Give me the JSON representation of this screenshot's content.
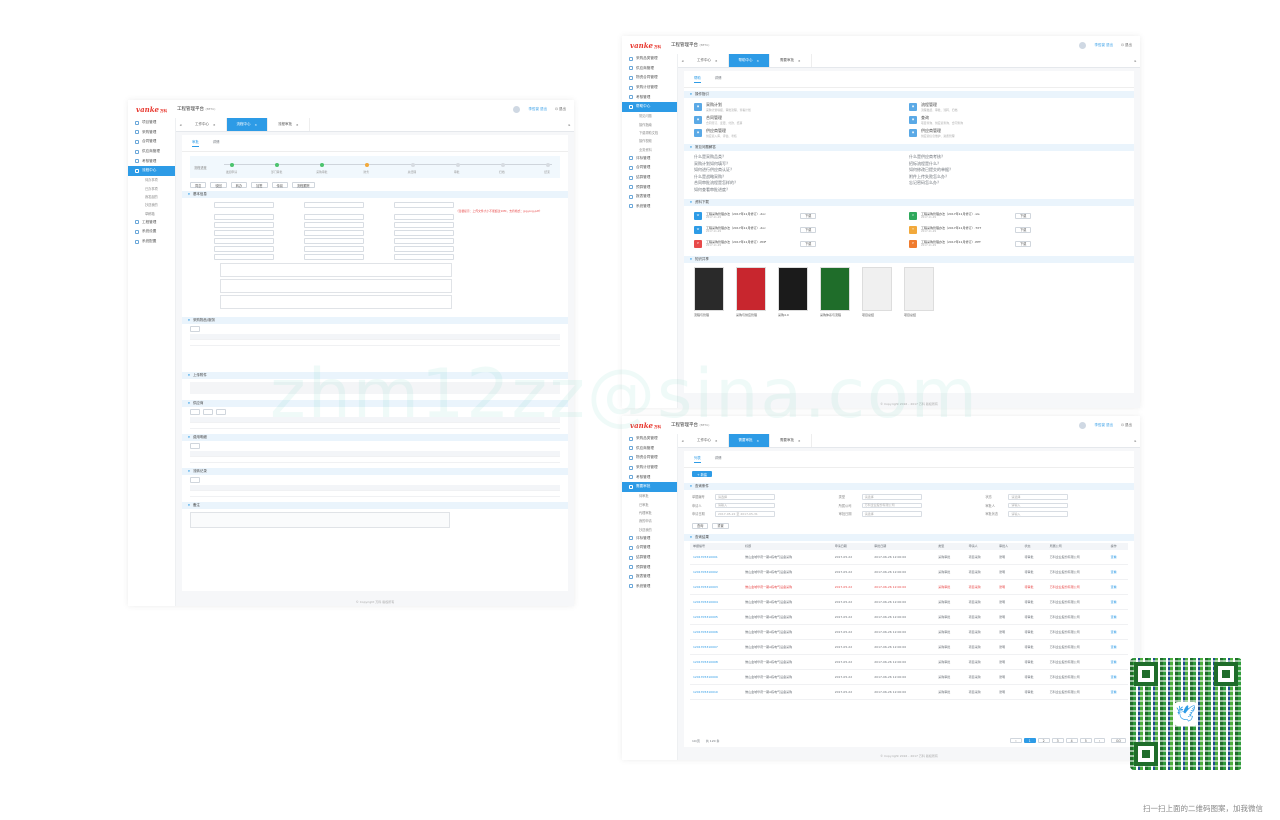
{
  "brand": {
    "logo": "vanke",
    "logo_cn": "万科",
    "app_title": "工程管理平台",
    "app_title_suffix": "(BETA)"
  },
  "colors": {
    "accent": "#2d9be6",
    "brand_red": "#e8382f",
    "done": "#4cc36e",
    "current": "#f2a93b"
  },
  "watermark": "zhm12zz@sina.com",
  "qr_caption": "扫一扫上面的二维码图案，加我微信",
  "left_screen": {
    "user": "李哲豪 退出",
    "logout": "退出",
    "nav": [
      {
        "label": "项目管理",
        "icon": "folder-icon"
      },
      {
        "label": "采购管理",
        "icon": "cart-icon"
      },
      {
        "label": "合同管理",
        "icon": "doc-icon"
      },
      {
        "label": "供应商管理",
        "icon": "users-icon"
      },
      {
        "label": "考核管理",
        "icon": "check-icon"
      },
      {
        "label": "流程中心",
        "icon": "flow-icon",
        "active": true
      },
      {
        "label": "待办事项",
        "sub": true
      },
      {
        "label": "已办事项",
        "sub": true
      },
      {
        "label": "我发起的",
        "sub": true
      },
      {
        "label": "抄送我的",
        "sub": true
      },
      {
        "label": "草稿箱",
        "sub": true
      },
      {
        "label": "工程管理",
        "icon": "build-icon"
      },
      {
        "label": "系统设置",
        "icon": "gear-icon"
      },
      {
        "label": "系统配置",
        "icon": "cog-icon"
      }
    ],
    "tabs": [
      "工作中心",
      "流程中心",
      "流程审批"
    ],
    "subtabs": [
      "审批",
      "详情"
    ],
    "flow_label": "流程进度",
    "steps": [
      "发起申请",
      "部门审批",
      "采购审批",
      "财务",
      "总经理",
      "审批",
      "归档",
      "结束"
    ],
    "actions": [
      "同意",
      "驳回",
      "转办",
      "加签",
      "传阅",
      "流程跟踪"
    ],
    "sections": [
      "基本信息",
      "采购物品/服务",
      "上传附件",
      "供应商",
      "费用明细",
      "流转记录",
      "备注"
    ],
    "warning": "（温馨提示：上传文件大小不能超过10M，支持格式：jpg,png,pdf）",
    "footer": "© Copyright 万科 版权所有"
  },
  "right_top": {
    "user": "李哲豪 退出",
    "logout": "退出",
    "nav": [
      {
        "label": "采购品类管理"
      },
      {
        "label": "供应商管理"
      },
      {
        "label": "物资合同管理"
      },
      {
        "label": "采购计划管理"
      },
      {
        "label": "考核管理"
      },
      {
        "label": "帮助中心",
        "active": true
      },
      {
        "label": "常见问题",
        "sub": true
      },
      {
        "label": "操作指南",
        "sub": true
      },
      {
        "label": "下载帮助文档",
        "sub": true
      },
      {
        "label": "操作视频",
        "sub": true
      },
      {
        "label": "业务资料",
        "sub": true
      },
      {
        "label": "评标管理"
      },
      {
        "label": "合同管理"
      },
      {
        "label": "结算管理"
      },
      {
        "label": "预算管理"
      },
      {
        "label": "报表管理"
      },
      {
        "label": "系统管理"
      }
    ],
    "tabs": [
      "工作中心",
      "帮助中心",
      "需要审批"
    ],
    "subtabs": [
      "帮助",
      "详情"
    ],
    "guide_section": "操作指引",
    "guides": [
      {
        "title": "采购计划",
        "desc": "采购计划填报、审批流程、查看计划"
      },
      {
        "title": "流程管理",
        "desc": "流程发起、审批、流转、归档"
      },
      {
        "title": "合同管理",
        "desc": "合同签订、变更、付款、结算"
      },
      {
        "title": "查询",
        "desc": "项目查询、供应商查询、合同查询"
      },
      {
        "title": "供应商管理",
        "desc": "供应商入库、评估、考核"
      },
      {
        "title": "供应商管理",
        "desc": "供应商信息维护、资质管理"
      }
    ],
    "faq_section": "常见问题解答",
    "faqs_left": [
      "什么是采购品类？",
      "采购计划如何填写？",
      "如何进行供应商认证？",
      "什么是战略采购？",
      "合同审批流程是怎样的？",
      "如何查看审批进度？"
    ],
    "faqs_right": [
      "什么是供应商考核？",
      "招标流程是什么？",
      "如何修改已提交的单据？",
      "附件上传失败怎么办？",
      "忘记密码怎么办？"
    ],
    "download_section": "资料下载",
    "downloads": [
      {
        "name": "工程采购管理办法（2017年11月修订）.doc",
        "meta": "2017-11-29",
        "badge": "W",
        "color": "#2d9be6",
        "btn": "下载"
      },
      {
        "name": "工程采购管理办法（2017年11月修订）.xls",
        "meta": "2017-11-29",
        "badge": "X",
        "color": "#2fa95c",
        "btn": "下载"
      },
      {
        "name": "工程采购管理办法（2017年11月修订）.doc",
        "meta": "2017-11-29",
        "badge": "W",
        "color": "#2d9be6",
        "btn": "下载"
      },
      {
        "name": "工程采购管理办法（2017年11月修订）.TXT",
        "meta": "2017-11-29",
        "badge": "T",
        "color": "#f2a93b",
        "btn": "下载"
      },
      {
        "name": "工程采购管理办法（2017年11月修订）.PDF",
        "meta": "2017-11-29",
        "badge": "P",
        "color": "#e84a4a",
        "btn": "下载"
      },
      {
        "name": "工程采购管理办法（2017年11月修订）.PPT",
        "meta": "2017-11-29",
        "badge": "P",
        "color": "#f07b2e",
        "btn": "下载"
      }
    ],
    "book_section": "知识共享",
    "books": [
      {
        "title": "流程与管理",
        "color": "#2a2a2a"
      },
      {
        "title": "采购与供应管理",
        "color": "#c8262e"
      },
      {
        "title": "采购4.0",
        "color": "#1b1b1b"
      },
      {
        "title": "采购体系与流程",
        "color": "#1f6d2a"
      },
      {
        "title": "项目总结",
        "color": "#f0f0f0"
      },
      {
        "title": "项目总结",
        "color": "#f0f0f0"
      }
    ],
    "footer": "© Copyright 2016 - 2017 万科 版权所有"
  },
  "right_bottom": {
    "user": "李哲豪 退出",
    "logout": "退出",
    "nav": [
      {
        "label": "采购品类管理"
      },
      {
        "label": "供应商管理"
      },
      {
        "label": "物资合同管理"
      },
      {
        "label": "采购计划管理"
      },
      {
        "label": "考核管理"
      },
      {
        "label": "需要审批",
        "active": true
      },
      {
        "label": "待审批",
        "sub": true
      },
      {
        "label": "已审批",
        "sub": true
      },
      {
        "label": "代理审批",
        "sub": true
      },
      {
        "label": "我的申请",
        "sub": true
      },
      {
        "label": "抄送我的",
        "sub": true
      },
      {
        "label": "评标管理"
      },
      {
        "label": "合同管理"
      },
      {
        "label": "结算管理"
      },
      {
        "label": "预算管理"
      },
      {
        "label": "报表管理"
      },
      {
        "label": "系统管理"
      }
    ],
    "tabs": [
      "工作中心",
      "需要审批",
      "需要审批"
    ],
    "subtabs": [
      "列表",
      "详情"
    ],
    "new_btn": "+ 新建",
    "query_section": "查询条件",
    "filters": [
      {
        "label": "单据编号",
        "value": "请选择"
      },
      {
        "label": "类型",
        "value": "请选择"
      },
      {
        "label": "状态",
        "value": "请选择"
      },
      {
        "label": "申请人",
        "value": "请输入"
      },
      {
        "label": "所属公司",
        "value": "万科企业股份有限公司"
      },
      {
        "label": "审批人",
        "value": "请输入"
      },
      {
        "label": "申请日期",
        "value": "2017-05-22 至 2017-05-31"
      },
      {
        "label": "审批日期",
        "value": "请选择"
      },
      {
        "label": "审批状态",
        "value": "请输入"
      }
    ],
    "query_btn": "查询",
    "reset_btn": "重置",
    "list_section": "查询结果",
    "columns": [
      "单据编号",
      "标题",
      "申请日期",
      "审批日期",
      "类型",
      "申请人",
      "审批人",
      "状态",
      "所属公司",
      "操作"
    ],
    "rows": [
      {
        "no": "1201705310001",
        "title": "佛山金域华府一期A栋电气设备采购",
        "d1": "2017-05-22",
        "d2": "2017-06-26 12:00:00",
        "type": "采购审批",
        "app": "项目采购",
        "apr": "张明",
        "st": "待审批",
        "co": "万科企业股份有限公司"
      },
      {
        "no": "1201705310002",
        "title": "佛山金域华府一期A栋电气设备采购",
        "d1": "2017-05-22",
        "d2": "2017-06-26 12:00:00",
        "type": "采购审批",
        "app": "项目采购",
        "apr": "张明",
        "st": "待审批",
        "co": "万科企业股份有限公司"
      },
      {
        "no": "1201705310003",
        "title": "佛山金域华府一期A栋电气设备采购",
        "d1": "2017-05-22",
        "d2": "2017-06-26 12:00:00",
        "type": "采购审批",
        "app": "项目采购",
        "apr": "张明",
        "st": "待审批",
        "co": "万科企业股份有限公司",
        "alert": true
      },
      {
        "no": "1201705310004",
        "title": "佛山金域华府一期A栋电气设备采购",
        "d1": "2017-05-22",
        "d2": "2017-06-26 12:00:00",
        "type": "采购审批",
        "app": "项目采购",
        "apr": "张明",
        "st": "待审批",
        "co": "万科企业股份有限公司"
      },
      {
        "no": "1201705310005",
        "title": "佛山金域华府一期A栋电气设备采购",
        "d1": "2017-05-22",
        "d2": "2017-06-26 12:00:00",
        "type": "采购审批",
        "app": "项目采购",
        "apr": "张明",
        "st": "待审批",
        "co": "万科企业股份有限公司"
      },
      {
        "no": "1201705310006",
        "title": "佛山金域华府一期A栋电气设备采购",
        "d1": "2017-05-22",
        "d2": "2017-06-26 12:00:00",
        "type": "采购审批",
        "app": "项目采购",
        "apr": "张明",
        "st": "待审批",
        "co": "万科企业股份有限公司"
      },
      {
        "no": "1201705310007",
        "title": "佛山金域华府一期A栋电气设备采购",
        "d1": "2017-05-22",
        "d2": "2017-06-26 12:00:00",
        "type": "采购审批",
        "app": "项目采购",
        "apr": "张明",
        "st": "待审批",
        "co": "万科企业股份有限公司"
      },
      {
        "no": "1201705310008",
        "title": "佛山金域华府一期A栋电气设备采购",
        "d1": "2017-05-22",
        "d2": "2017-06-26 12:00:00",
        "type": "采购审批",
        "app": "项目采购",
        "apr": "张明",
        "st": "待审批",
        "co": "万科企业股份有限公司"
      },
      {
        "no": "1201705310009",
        "title": "佛山金域华府一期A栋电气设备采购",
        "d1": "2017-05-22",
        "d2": "2017-06-26 12:00:00",
        "type": "采购审批",
        "app": "项目采购",
        "apr": "张明",
        "st": "待审批",
        "co": "万科企业股份有限公司"
      },
      {
        "no": "1201705310010",
        "title": "佛山金域华府一期A栋电气设备采购",
        "d1": "2017-05-22",
        "d2": "2017-06-26 12:00:00",
        "type": "采购审批",
        "app": "项目采购",
        "apr": "张明",
        "st": "待审批",
        "co": "万科企业股份有限公司"
      }
    ],
    "action_label": "查看",
    "pager_info": "10/页",
    "pager_total": "共 120 条",
    "pages": [
      "1",
      "2",
      "3",
      "4",
      "5"
    ],
    "goto": "GO",
    "footer": "© Copyright 2016 - 2017 万科 版权所有"
  }
}
